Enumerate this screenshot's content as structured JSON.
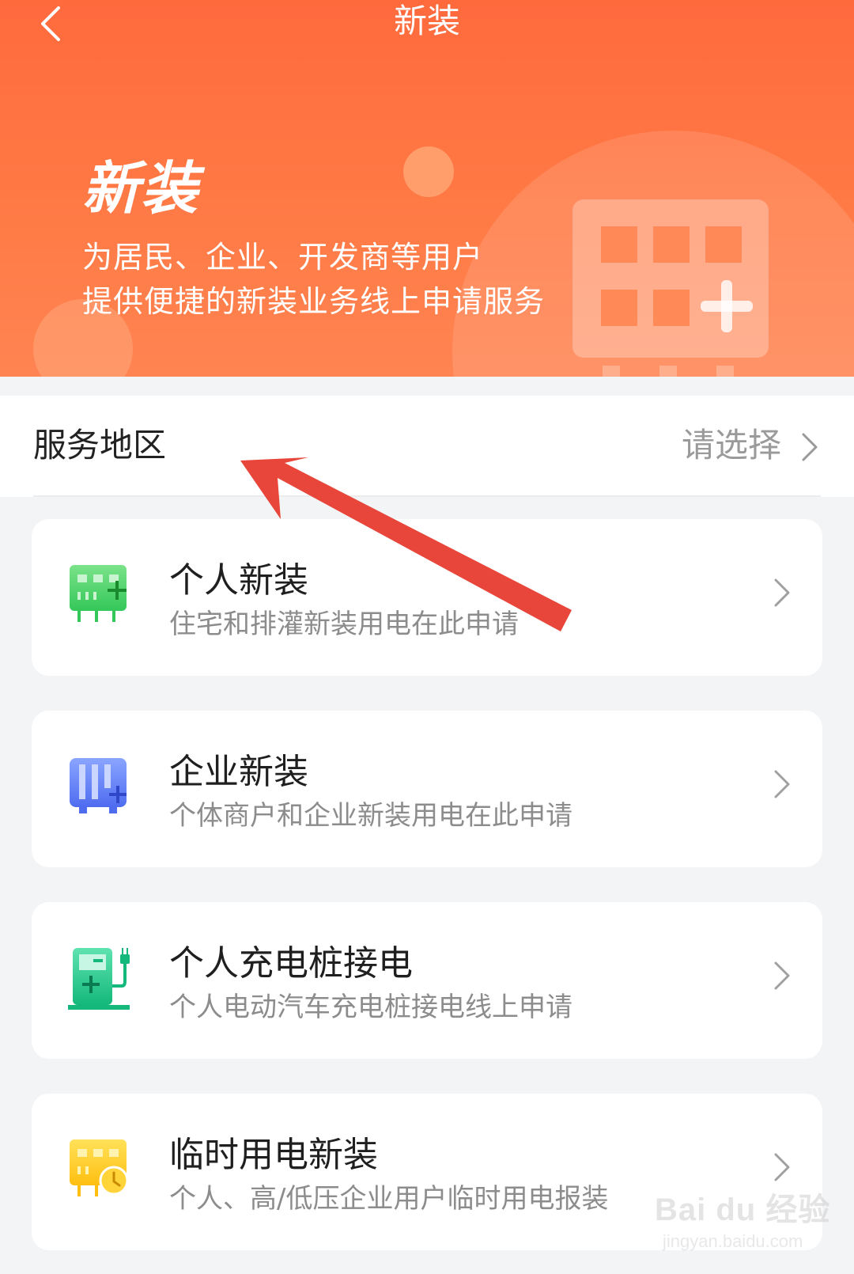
{
  "nav": {
    "title": "新装",
    "back_icon": "chevron-left-icon"
  },
  "hero": {
    "title": "新装",
    "desc_line1": "为居民、企业、开发商等用户",
    "desc_line2": "提供便捷的新装业务线上申请服务",
    "illustration": "meter-plus-icon"
  },
  "service_area": {
    "label": "服务地区",
    "value": "请选择"
  },
  "cards": [
    {
      "title": "个人新装",
      "subtitle": "住宅和排灌新装用电在此申请",
      "icon": "residential-meter-icon",
      "color": "#4cd964"
    },
    {
      "title": "企业新装",
      "subtitle": "个体商户和企业新装用电在此申请",
      "icon": "enterprise-meter-icon",
      "color": "#5b7cf7"
    },
    {
      "title": "个人充电桩接电",
      "subtitle": "个人电动汽车充电桩接电线上申请",
      "icon": "charging-pile-icon",
      "color": "#21c488"
    },
    {
      "title": "临时用电新装",
      "subtitle": "个人、高/低压企业用户临时用电报装",
      "icon": "temporary-meter-clock-icon",
      "color": "#ffc21a"
    }
  ],
  "annotation": {
    "arrow_color": "#e8463a"
  },
  "watermark": {
    "brand": "Bai du 经验",
    "url": "jingyan.baidu.com"
  }
}
